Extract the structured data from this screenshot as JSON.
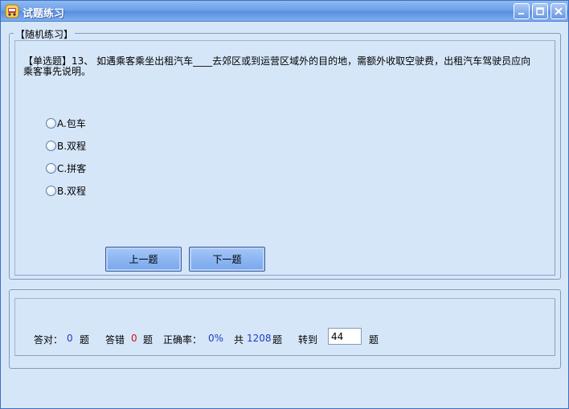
{
  "window": {
    "title": "试题练习",
    "controls": {
      "minimize": "minimize",
      "maximize": "maximize",
      "close": "close"
    }
  },
  "practice": {
    "legend": "【随机练习】",
    "question_line1": "【单选题】13、 如遇乘客乘坐出租汽车____去郊区或到运营区域外的目的地，需额外收取空驶费，出租汽车驾驶员应向",
    "question_line2": "乘客事先说明。",
    "options": [
      {
        "label": "A.包车"
      },
      {
        "label": "B.双程"
      },
      {
        "label": "C.拼客"
      },
      {
        "label": "B.双程"
      }
    ],
    "prev_label": "上一题",
    "next_label": "下一题"
  },
  "stats": {
    "correct_label": "答对：",
    "correct_value": "0",
    "unit": "题",
    "wrong_label": "答错",
    "wrong_value": "0",
    "rate_label": "正确率：",
    "rate_value": "0%",
    "total_prefix": "共",
    "total_value": "1208",
    "goto_label": "转到",
    "goto_value": "44"
  }
}
